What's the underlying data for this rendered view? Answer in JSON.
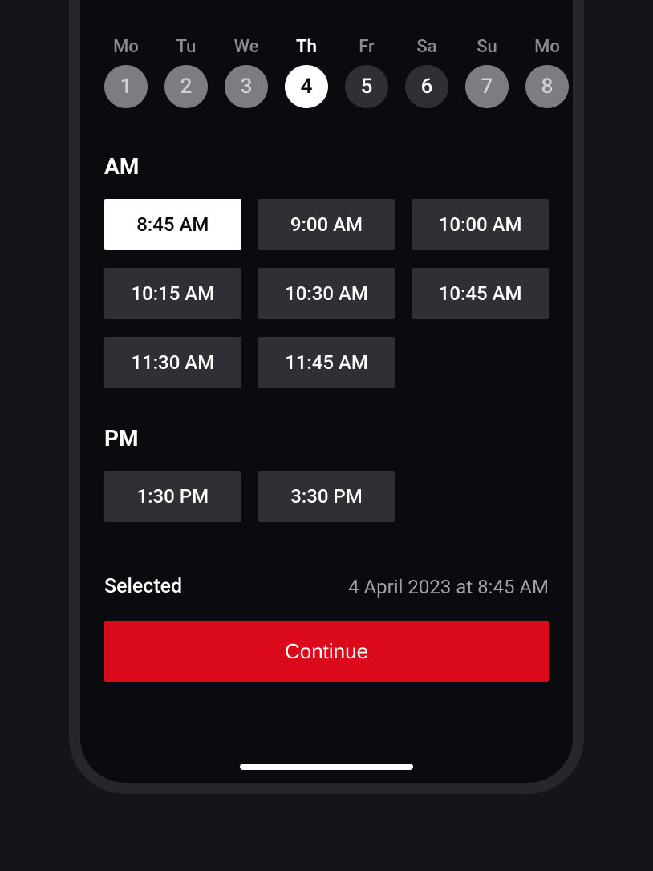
{
  "days": [
    {
      "label": "Mo",
      "num": "1",
      "style": "default"
    },
    {
      "label": "Tu",
      "num": "2",
      "style": "default"
    },
    {
      "label": "We",
      "num": "3",
      "style": "default"
    },
    {
      "label": "Th",
      "num": "4",
      "style": "selected"
    },
    {
      "label": "Fr",
      "num": "5",
      "style": "dark"
    },
    {
      "label": "Sa",
      "num": "6",
      "style": "dark"
    },
    {
      "label": "Su",
      "num": "7",
      "style": "default"
    },
    {
      "label": "Mo",
      "num": "8",
      "style": "default"
    }
  ],
  "am": {
    "header": "AM",
    "slots": [
      {
        "label": "8:45 AM",
        "selected": true
      },
      {
        "label": "9:00 AM",
        "selected": false
      },
      {
        "label": "10:00 AM",
        "selected": false
      },
      {
        "label": "10:15 AM",
        "selected": false
      },
      {
        "label": "10:30 AM",
        "selected": false
      },
      {
        "label": "10:45 AM",
        "selected": false
      },
      {
        "label": "11:30 AM",
        "selected": false
      },
      {
        "label": "11:45 AM",
        "selected": false
      }
    ]
  },
  "pm": {
    "header": "PM",
    "slots": [
      {
        "label": "1:30 PM",
        "selected": false
      },
      {
        "label": "3:30 PM",
        "selected": false
      }
    ]
  },
  "selected": {
    "label": "Selected",
    "value": "4 April 2023 at 8:45 AM"
  },
  "continue_label": "Continue"
}
